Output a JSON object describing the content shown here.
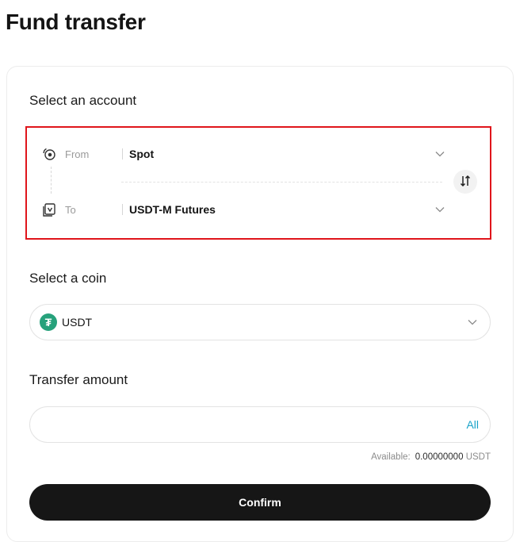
{
  "page": {
    "title": "Fund transfer"
  },
  "account": {
    "section_title": "Select an account",
    "from": {
      "label": "From",
      "value": "Spot",
      "icon": "spot-wallet-icon"
    },
    "to": {
      "label": "To",
      "value": "USDT-M Futures",
      "icon": "futures-wallet-icon"
    },
    "swap_icon": "swap-vertical-icon",
    "highlight_color": "#e0151b"
  },
  "coin": {
    "section_title": "Select a coin",
    "selected": "USDT",
    "logo_color": "#26a17b"
  },
  "amount": {
    "section_title": "Transfer amount",
    "value": "",
    "all_label": "All",
    "available_label": "Available:",
    "available_value": "0.00000000",
    "available_unit": "USDT"
  },
  "confirm_label": "Confirm"
}
